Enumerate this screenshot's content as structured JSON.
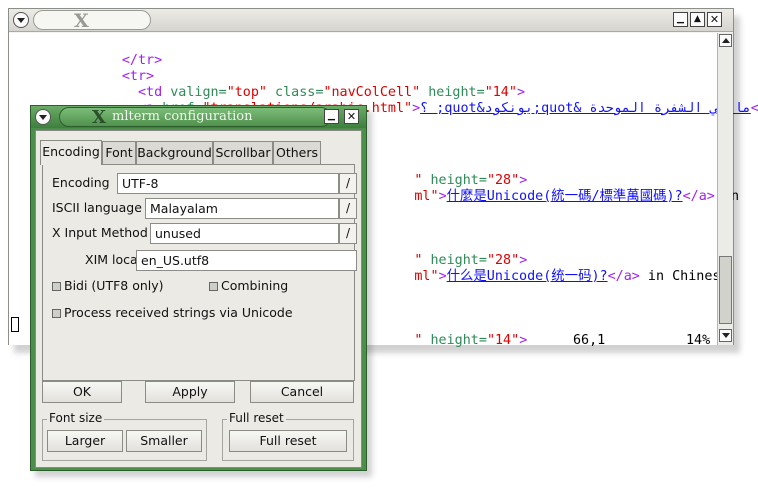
{
  "terminal": {
    "title_logo": "X",
    "buttons": {
      "minimize": "▁",
      "maximize": "▲",
      "close": "✕"
    },
    "lines": {
      "l1": {
        "indent": "        ",
        "t1": "</tr>"
      },
      "l2": {
        "indent": "        ",
        "t1": "<tr>"
      },
      "l3": {
        "indent": "          ",
        "t1": "<td ",
        "a1": "valign=",
        "s1": "\"top\"",
        "a2": " class=",
        "s2": "\"navColCell\"",
        "a3": " height=",
        "s3": "\"14\"",
        "t2": ">"
      },
      "l4": {
        "indent": "          ",
        "t1": "<a ",
        "a1": "href=",
        "s1": "\"translations/arabic.html\"",
        "t2": ">",
        "link": "ما هي الشفرة الموحدة &quot;يونكود&quot; ؟",
        "t3": "</"
      },
      "l5": {
        "frag": "\" ",
        "a1": "height=",
        "s1": "\"28\"",
        "t1": ">"
      },
      "l6": {
        "s1": "ml\"",
        "t1": ">",
        "link": "什麼是Unicode(統一碼/標準萬國碼)?",
        "t2": "</a>",
        "plain": " in"
      },
      "l7": {
        "frag": "\" ",
        "a1": "height=",
        "s1": "\"28\"",
        "t1": ">"
      },
      "l8": {
        "s1": "ml\"",
        "t1": ">",
        "link": "什么是Unicode(统一码)?",
        "t2": "</a>",
        "plain": " in Chinese"
      },
      "l9": {
        "frag": "\" ",
        "a1": "height=",
        "s1": "\"14\"",
        "t1": ">"
      }
    },
    "status": {
      "position": "66,1",
      "percent": "14%"
    }
  },
  "dialog": {
    "title": "mlterm configuration",
    "title_logo": "X",
    "buttons": {
      "minimize": "▁",
      "close": "✕"
    },
    "tabs": [
      "Encoding",
      "Font",
      "Background",
      "Scrollbar",
      "Others"
    ],
    "fields": {
      "encoding": {
        "label": "Encoding",
        "value": "UTF-8",
        "btn": "/"
      },
      "iscii": {
        "label": "ISCII language",
        "value": "Malayalam",
        "btn": "/"
      },
      "xim_method": {
        "label": "X Input Method",
        "value": "unused",
        "btn": "/"
      },
      "xim_locale": {
        "label": "XIM locale",
        "value": "en_US.utf8"
      }
    },
    "checks": {
      "bidi": "Bidi (UTF8 only)",
      "combining": "Combining",
      "unicode": "Process received strings via Unicode"
    },
    "actions": {
      "ok": "OK",
      "apply": "Apply",
      "cancel": "Cancel"
    },
    "font_size": {
      "label": "Font size",
      "larger": "Larger",
      "smaller": "Smaller"
    },
    "full_reset": {
      "label": "Full reset",
      "button": "Full reset"
    }
  }
}
